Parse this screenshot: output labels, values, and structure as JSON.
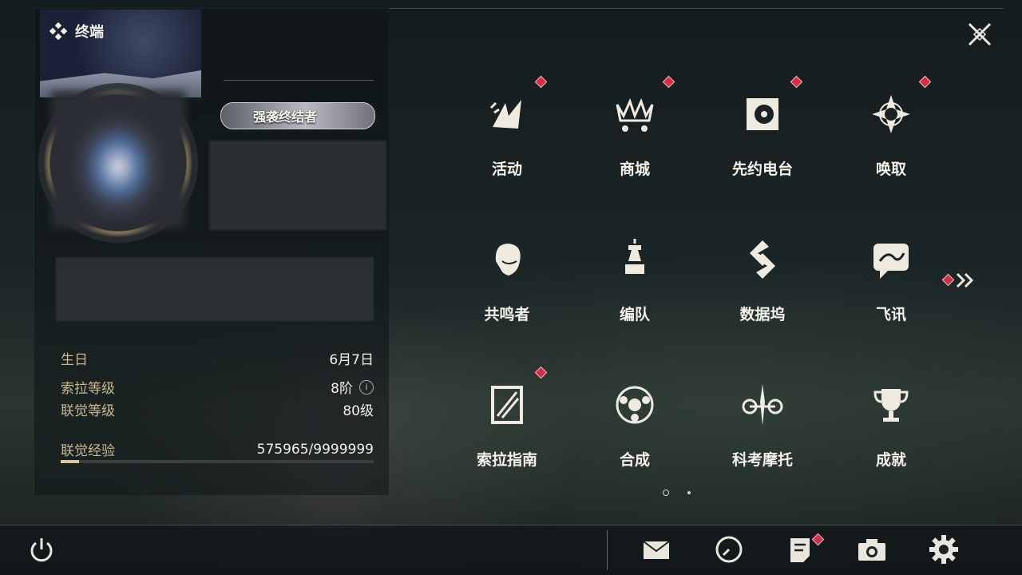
{
  "app": {
    "title": "终端"
  },
  "profile": {
    "badge": "强袭终结者",
    "birthday_label": "生日",
    "birthday_value": "6月7日",
    "sola_level_label": "索拉等级",
    "sola_level_value": "8阶",
    "union_level_label": "联觉等级",
    "union_level_value": "80级",
    "union_exp_label": "联觉经验",
    "union_exp_value": "575965/9999999",
    "exp_progress": 0.0576
  },
  "menu": {
    "items": [
      {
        "label": "活动",
        "icon": "activity-icon",
        "dot": true
      },
      {
        "label": "商城",
        "icon": "shop-crown-cart-icon",
        "dot": true
      },
      {
        "label": "先约电台",
        "icon": "radio-icon",
        "dot": true
      },
      {
        "label": "唤取",
        "icon": "convene-compass-icon",
        "dot": true
      },
      {
        "label": "共鸣者",
        "icon": "resonator-head-icon",
        "dot": false
      },
      {
        "label": "编队",
        "icon": "chess-team-icon",
        "dot": false
      },
      {
        "label": "数据坞",
        "icon": "data-dock-icon",
        "dot": false
      },
      {
        "label": "飞讯",
        "icon": "message-icon",
        "dot": false
      },
      {
        "label": "索拉指南",
        "icon": "guide-icon",
        "dot": true
      },
      {
        "label": "合成",
        "icon": "synthesis-icon",
        "dot": false
      },
      {
        "label": "科考摩托",
        "icon": "motorcycle-icon",
        "dot": false
      },
      {
        "label": "成就",
        "icon": "trophy-icon",
        "dot": false
      }
    ],
    "page_count": 2,
    "current_page": 1
  },
  "bottom_bar": {
    "icons": [
      "power-icon",
      "mail-icon",
      "clock-icon",
      "notes-icon",
      "camera-icon",
      "settings-icon"
    ]
  },
  "colors": {
    "accent_gold": "#c9b891",
    "notify_red": "#c9324a"
  }
}
